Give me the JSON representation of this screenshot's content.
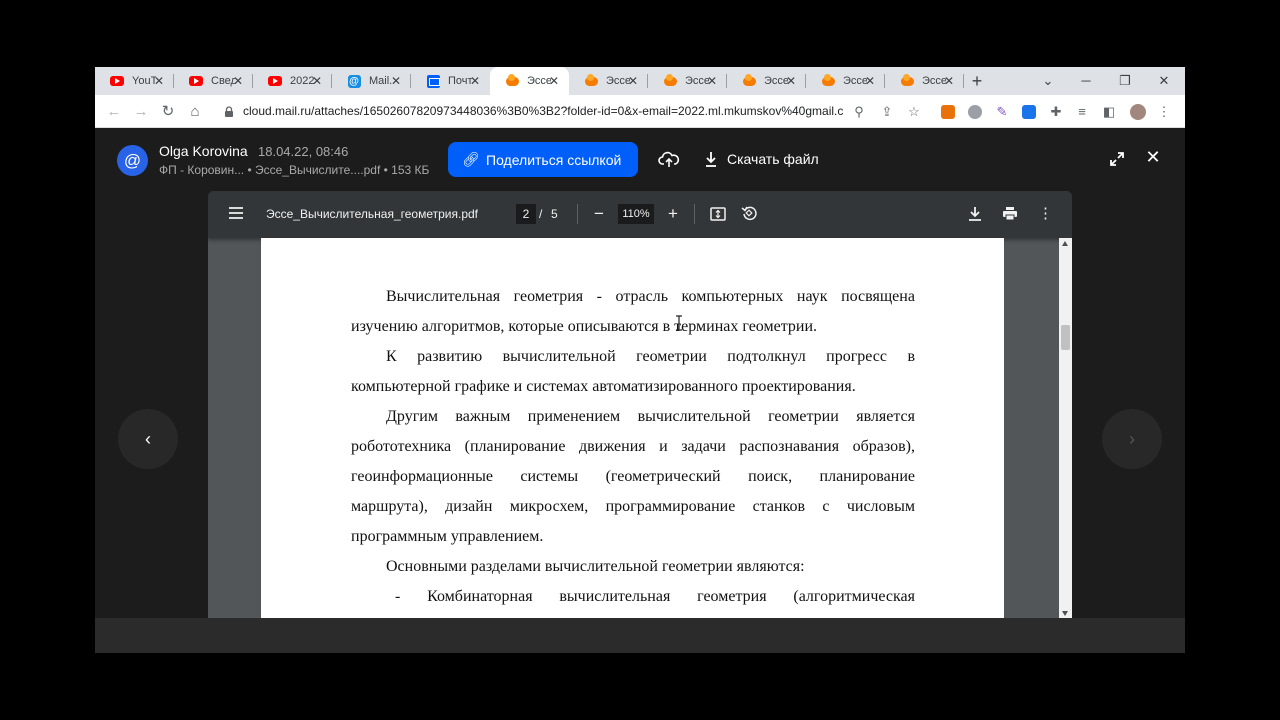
{
  "tabs": [
    {
      "icon": "youtube-icon",
      "title": "YouTube"
    },
    {
      "icon": "youtube-icon",
      "title": "Сведения"
    },
    {
      "icon": "youtube-icon",
      "title": "2022"
    },
    {
      "icon": "mail-at-icon",
      "title": "Mail.ru"
    },
    {
      "icon": "mail-envelope-icon",
      "title": "Почта"
    },
    {
      "icon": "cloud-icon",
      "title": "Эссе",
      "active": true
    },
    {
      "icon": "cloud-icon",
      "title": "Эссе"
    },
    {
      "icon": "cloud-icon",
      "title": "Эссе"
    },
    {
      "icon": "cloud-icon",
      "title": "Эссе"
    },
    {
      "icon": "cloud-icon",
      "title": "Эссе"
    },
    {
      "icon": "cloud-icon",
      "title": "Эссе"
    }
  ],
  "address_bar": {
    "url": "cloud.mail.ru/attaches/16502607820973448036%3B0%3B2?folder-id=0&x-email=2022.ml.mkumskov%40gmail.c..."
  },
  "viewer": {
    "sender_name": "Olga Korovina",
    "date": "18.04.22, 08:46",
    "file_info": "ФП - Коровин... • Эссе_Вычислите....pdf • 153 КБ",
    "share_label": "Поделиться ссылкой",
    "download_label": "Скачать файл",
    "avatar_glyph": "@"
  },
  "pdf": {
    "filename": "Эссе_Вычислительная_геометрия.pdf",
    "current_page": "2",
    "page_separator": "/",
    "total_pages": "5",
    "zoom": "110%",
    "lines": [
      {
        "text": "Вычислительная геометрия - отрасль компьютерных наук посвящена",
        "style": "indent-justify"
      },
      {
        "text": "изучению алгоритмов, которые описываются в терминах геометрии.",
        "style": "plain"
      },
      {
        "text": "К развитию вычислительной геометрии подтолкнул прогресс в",
        "style": "indent-justify"
      },
      {
        "text": "компьютерной графике и системах автоматизированного проектирования.",
        "style": "plain"
      },
      {
        "text": "Другим важным применением вычислительной геометрии является",
        "style": "indent-justify"
      },
      {
        "text": "робототехника (планирование движения и задачи распознавания образов),",
        "style": "justify"
      },
      {
        "text": "геоинформационные системы (геометрический поиск, планирование",
        "style": "justify"
      },
      {
        "text": "маршрута), дизайн микросхем, программирование станков с числовым",
        "style": "justify"
      },
      {
        "text": "программным управлением.",
        "style": "plain"
      },
      {
        "text": "Основными разделами вычислительной геометрии являются:",
        "style": "indent"
      },
      {
        "text": "- Комбинаторная вычислительная геометрия (алгоритмическая",
        "style": "bullet-justify"
      }
    ]
  },
  "colors": {
    "share_button": "#005ff9",
    "avatar_bg": "#2862e6",
    "viewer_bg": "#1c1c1c",
    "pdf_toolbar": "#323639",
    "pdf_bg": "#525659",
    "youtube_red": "#ff0000",
    "cloud_orange": "#f57c00"
  }
}
